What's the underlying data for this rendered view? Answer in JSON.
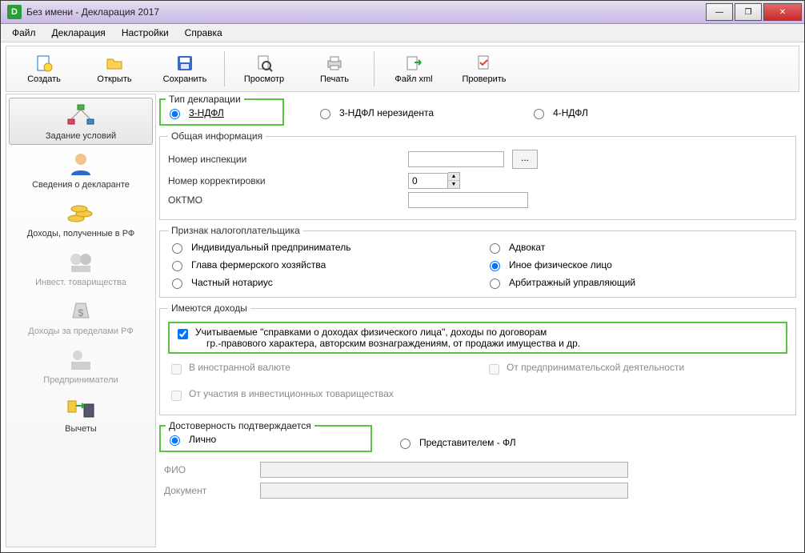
{
  "window": {
    "title": "Без имени - Декларация 2017"
  },
  "menu": {
    "file": "Файл",
    "decl": "Декларация",
    "settings": "Настройки",
    "help": "Справка"
  },
  "toolbar": {
    "create": "Создать",
    "open": "Открыть",
    "save": "Сохранить",
    "preview": "Просмотр",
    "print": "Печать",
    "filexml": "Файл xml",
    "check": "Проверить"
  },
  "sidebar": {
    "conditions": "Задание условий",
    "declarant": "Сведения о декларанте",
    "income_rf": "Доходы, полученные в РФ",
    "invest": "Инвест. товарищества",
    "income_abroad": "Доходы за пределами РФ",
    "entrepreneurs": "Предприниматели",
    "deductions": "Вычеты"
  },
  "decl_type": {
    "legend": "Тип декларации",
    "opt1": "3-НДФЛ",
    "opt2": "3-НДФЛ нерезидента",
    "opt3": "4-НДФЛ"
  },
  "general": {
    "legend": "Общая информация",
    "inspection": "Номер инспекции",
    "correction": "Номер корректировки",
    "correction_val": "0",
    "oktmo": "ОКТМО"
  },
  "taxpayer": {
    "legend": "Признак налогоплательщика",
    "ip": "Индивидуальный предприниматель",
    "lawyer": "Адвокат",
    "farmer": "Глава фермерского хозяйства",
    "other_phys": "Иное физическое лицо",
    "notary": "Частный нотариус",
    "arbitr": "Арбитражный управляющий"
  },
  "income": {
    "legend": "Имеются доходы",
    "spravka1": "Учитываемые \"справками о доходах физического лица\", доходы по договорам",
    "spravka2": "гр.-правового характера, авторским вознаграждениям, от продажи имущества и др.",
    "foreign": "В иностранной валюте",
    "business": "От предпринимательской деятельности",
    "invest": "От участия в инвестиционных товариществах"
  },
  "confirm": {
    "legend": "Достоверность подтверждается",
    "self": "Лично",
    "rep": "Представителем - ФЛ",
    "fio": "ФИО",
    "doc": "Документ"
  }
}
